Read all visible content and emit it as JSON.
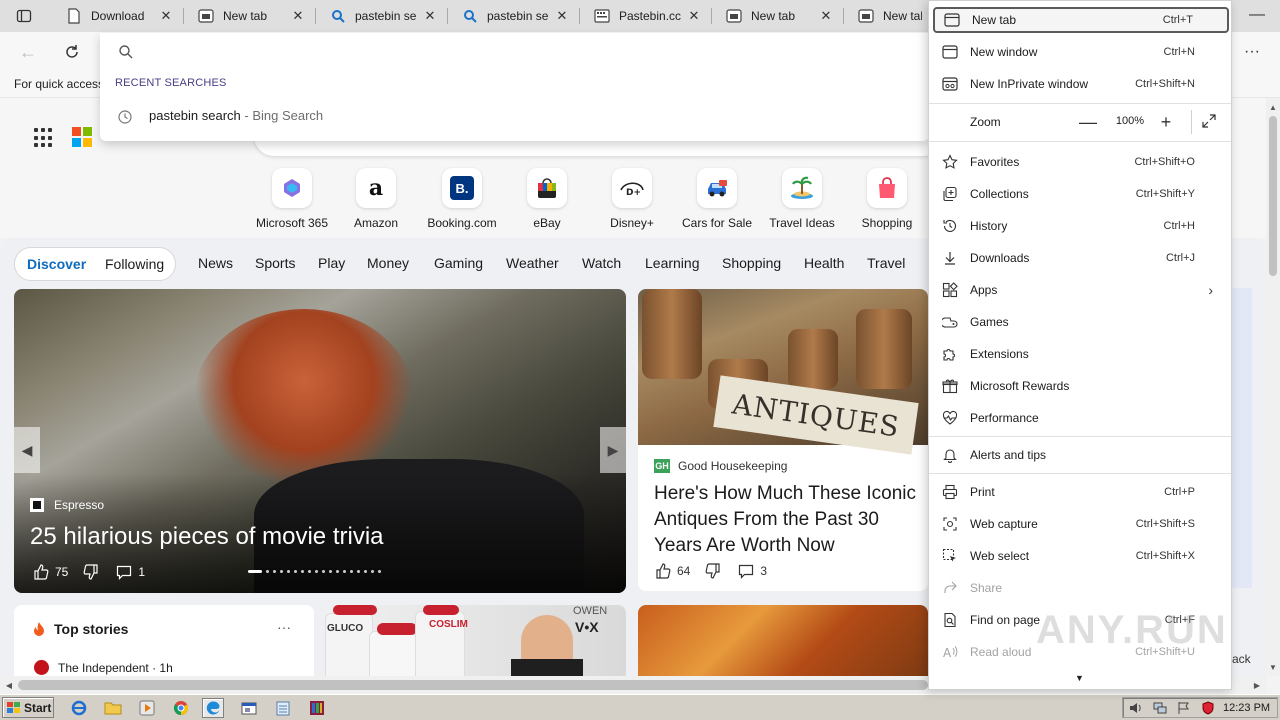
{
  "tabs": [
    {
      "label": "Download",
      "icon": "page-icon"
    },
    {
      "label": "New tab",
      "icon": "newtab-icon"
    },
    {
      "label": "pastebin se",
      "icon": "search-icon"
    },
    {
      "label": "pastebin se",
      "icon": "search-icon"
    },
    {
      "label": "Pastebin.cc",
      "icon": "pastebin-icon"
    },
    {
      "label": "New tab",
      "icon": "newtab-icon"
    },
    {
      "label": "New tab",
      "icon": "newtab-icon"
    }
  ],
  "favorites_bar": {
    "text": "For quick access"
  },
  "address_dropdown": {
    "recent_heading": "RECENT SEARCHES",
    "recent_query": "pastebin search",
    "recent_source": " - Bing Search"
  },
  "quick_links": [
    {
      "label": "Microsoft 365"
    },
    {
      "label": "Amazon"
    },
    {
      "label": "Booking.com"
    },
    {
      "label": "eBay"
    },
    {
      "label": "Disney+"
    },
    {
      "label": "Cars for Sale"
    },
    {
      "label": "Travel Ideas"
    },
    {
      "label": "Shopping"
    }
  ],
  "feed": {
    "tabs": [
      "Discover",
      "Following"
    ],
    "categories": [
      "News",
      "Sports",
      "Play",
      "Money",
      "Gaming",
      "Weather",
      "Watch",
      "Learning",
      "Shopping",
      "Health",
      "Travel"
    ]
  },
  "cards": {
    "main": {
      "source": "Espresso",
      "headline": "25 hilarious pieces of movie trivia",
      "likes": "75",
      "comments": "1"
    },
    "antiques": {
      "source": "Good Housekeeping",
      "headline": "Here's How Much These Iconic Antiques From the Past 30 Years Are Worth Now",
      "likes": "64",
      "comments": "3",
      "sign": "ANTIQUES"
    },
    "top_stories": {
      "title": "Top stories",
      "more": "···",
      "publisher": "The Independent · 1h"
    },
    "ad": {
      "brand1": "GLUCO",
      "brand2": "COSLIM",
      "brand3": "OWEN",
      "logo": "V•X"
    }
  },
  "menu": {
    "items": [
      {
        "label": "New tab",
        "shortcut": "Ctrl+T",
        "icon": "new-tab-icon"
      },
      {
        "label": "New window",
        "shortcut": "Ctrl+N",
        "icon": "new-window-icon"
      },
      {
        "label": "New InPrivate window",
        "shortcut": "Ctrl+Shift+N",
        "icon": "inprivate-icon"
      },
      {
        "label": "Favorites",
        "shortcut": "Ctrl+Shift+O",
        "icon": "star-icon"
      },
      {
        "label": "Collections",
        "shortcut": "Ctrl+Shift+Y",
        "icon": "collections-icon"
      },
      {
        "label": "History",
        "shortcut": "Ctrl+H",
        "icon": "history-icon"
      },
      {
        "label": "Downloads",
        "shortcut": "Ctrl+J",
        "icon": "download-icon"
      },
      {
        "label": "Apps",
        "shortcut": "",
        "icon": "apps-icon"
      },
      {
        "label": "Games",
        "shortcut": "",
        "icon": "games-icon"
      },
      {
        "label": "Extensions",
        "shortcut": "",
        "icon": "puzzle-icon"
      },
      {
        "label": "Microsoft Rewards",
        "shortcut": "",
        "icon": "rewards-icon"
      },
      {
        "label": "Performance",
        "shortcut": "",
        "icon": "heartbeat-icon"
      },
      {
        "label": "Alerts and tips",
        "shortcut": "",
        "icon": "bell-icon"
      },
      {
        "label": "Print",
        "shortcut": "Ctrl+P",
        "icon": "printer-icon"
      },
      {
        "label": "Web capture",
        "shortcut": "Ctrl+Shift+S",
        "icon": "capture-icon"
      },
      {
        "label": "Web select",
        "shortcut": "Ctrl+Shift+X",
        "icon": "select-icon"
      },
      {
        "label": "Share",
        "shortcut": "",
        "icon": "share-icon"
      },
      {
        "label": "Find on page",
        "shortcut": "Ctrl+F",
        "icon": "find-icon"
      },
      {
        "label": "Read aloud",
        "shortcut": "Ctrl+Shift+U",
        "icon": "read-aloud-icon"
      }
    ],
    "zoom": {
      "label": "Zoom",
      "value": "100%",
      "minus": "—",
      "plus": "+"
    }
  },
  "watermark": "ANY.RUN",
  "partial_back": "ack",
  "taskbar": {
    "start": "Start",
    "clock": "12:23 PM"
  },
  "colors": {
    "accent": "#0f6cbd",
    "taskbar": "#d4d0c8",
    "menu_bg": "#ffffff"
  }
}
